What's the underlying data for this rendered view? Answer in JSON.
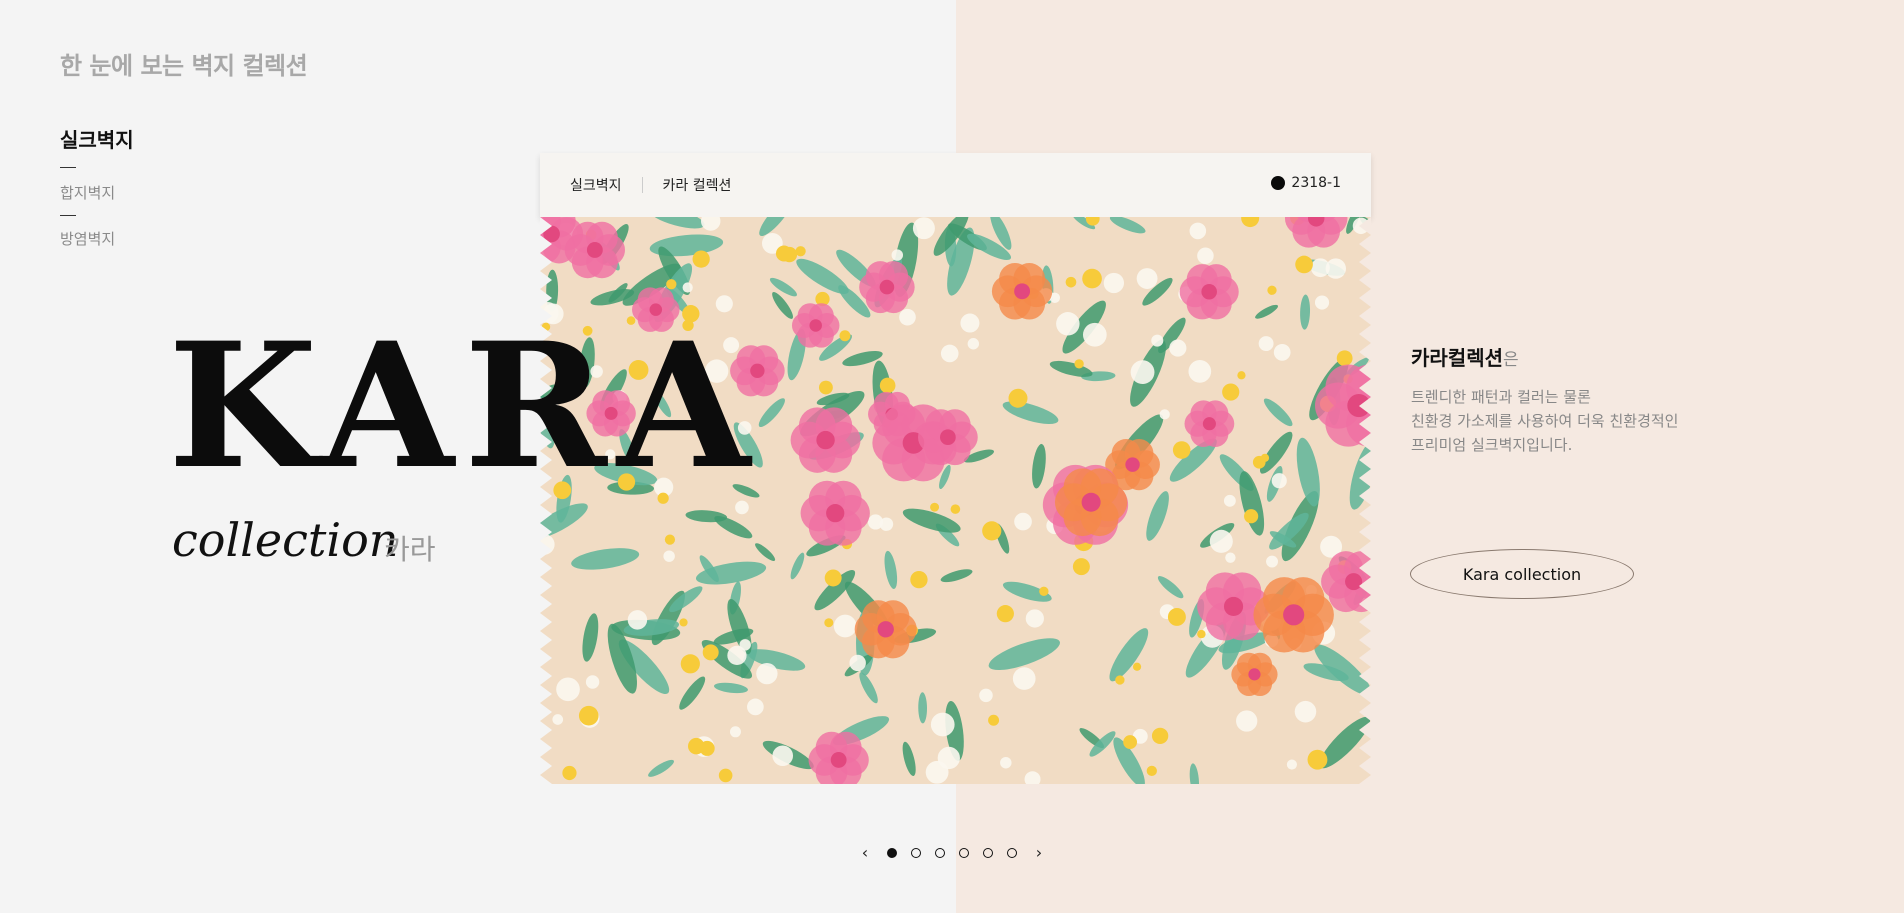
{
  "page_heading": "한 눈에 보는 벽지 컬렉션",
  "categories": [
    {
      "label": "실크벽지",
      "active": true
    },
    {
      "label": "합지벽지",
      "active": false
    },
    {
      "label": "방염벽지",
      "active": false
    }
  ],
  "hero": {
    "title": "KARA",
    "subtitle": "collection",
    "subtitle_ko": "카라"
  },
  "card": {
    "breadcrumb": [
      "실크벽지",
      "카라 컬렉션"
    ],
    "product_code": "2318-1",
    "colors": {
      "background": "#f1dcc4",
      "pink": "#f06fa3",
      "orange": "#f5894a",
      "yellow": "#f7cb3a",
      "green": "#3f9a6e",
      "teal": "#5fb59a",
      "white": "#fbf7ef"
    }
  },
  "description": {
    "title": "카라컬렉션",
    "title_suffix": "은",
    "lines": [
      "트렌디한 패턴과 컬러는 물론",
      "친환경 가소제를 사용하여 더욱 친환경적인",
      "프리미엄 실크벽지입니다."
    ]
  },
  "cta_button": "Kara collection",
  "pagination": {
    "prev": "‹",
    "next": "›",
    "total": 6,
    "current": 1
  },
  "theme": {
    "left_bg": "#f4f4f4",
    "right_bg": "#f5e9e1"
  }
}
